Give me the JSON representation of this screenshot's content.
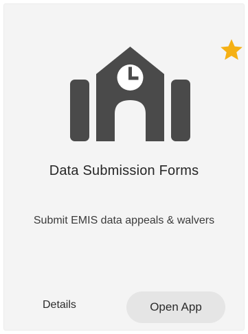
{
  "card": {
    "title": "Data Submission Forms",
    "description": "Submit EMIS data appeals & walvers",
    "favorite": true,
    "details_label": "Details",
    "open_label": "Open App",
    "icon": "school-building-clock-icon"
  },
  "colors": {
    "star": "#f5b014",
    "icon": "#4a4a4a",
    "card_bg": "#f4f4f4",
    "button_bg": "#e5e5e5"
  }
}
